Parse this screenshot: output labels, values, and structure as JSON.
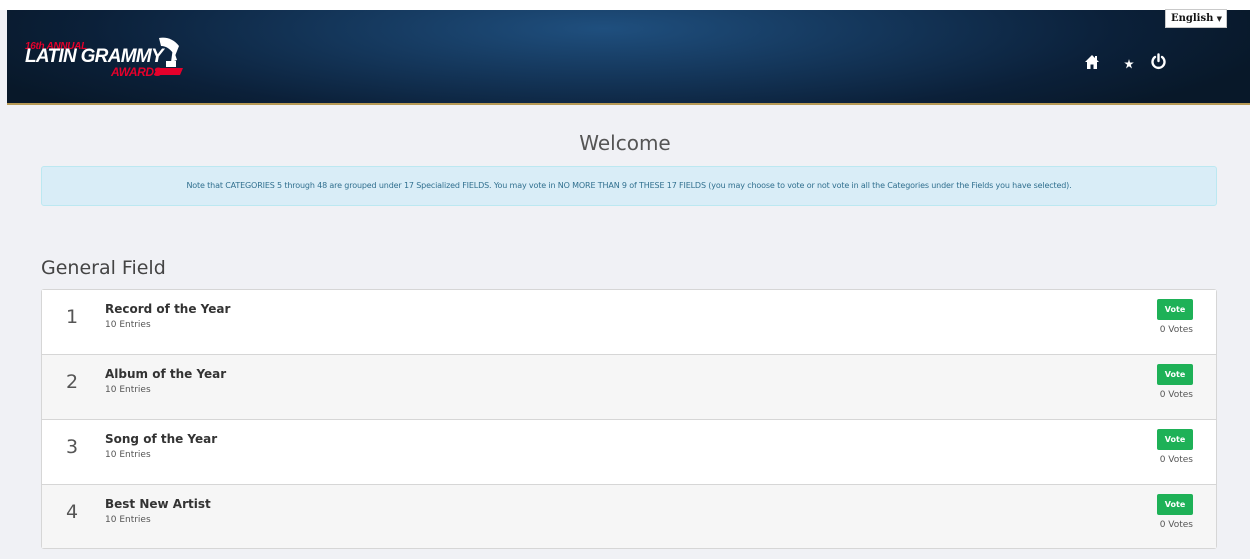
{
  "language": {
    "selected": "English"
  },
  "logo": {
    "edition": "16th ANNUAL",
    "name": "LATIN GRAMMY",
    "awards": "AWARDS"
  },
  "header_icons": [
    "home-icon",
    "star-icon",
    "power-icon"
  ],
  "welcome": {
    "title": "Welcome",
    "notice": "Note that CATEGORIES 5 through 48 are grouped under 17 Specialized FIELDS. You may vote in NO MORE THAN 9 of THESE 17 FIELDS (you may choose to vote or not vote in all the Categories under the Fields you have selected)."
  },
  "field": {
    "title": "General Field",
    "categories": [
      {
        "number": "1",
        "name": "Record of the Year",
        "entries": "10 Entries",
        "vote_label": "Vote",
        "votes": "0 Votes"
      },
      {
        "number": "2",
        "name": "Album of the Year",
        "entries": "10 Entries",
        "vote_label": "Vote",
        "votes": "0 Votes"
      },
      {
        "number": "3",
        "name": "Song of the Year",
        "entries": "10 Entries",
        "vote_label": "Vote",
        "votes": "0 Votes"
      },
      {
        "number": "4",
        "name": "Best New Artist",
        "entries": "10 Entries",
        "vote_label": "Vote",
        "votes": "0 Votes"
      }
    ]
  },
  "colors": {
    "header": "#0b2039",
    "accent_gold": "#b79a55",
    "vote_green": "#1eb157",
    "notice_bg": "#d9edf7",
    "logo_red": "#e4002b"
  }
}
